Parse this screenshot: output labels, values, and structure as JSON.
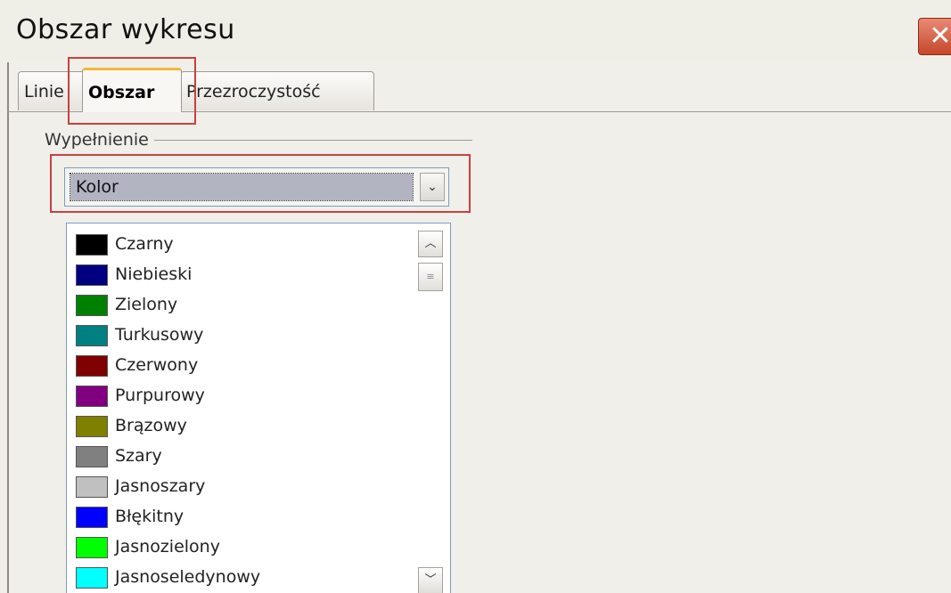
{
  "window": {
    "title": "Obszar wykresu",
    "close_glyph": "✕"
  },
  "tabs": [
    {
      "label": "Linie"
    },
    {
      "label": "Obszar"
    },
    {
      "label": "Przezroczystość"
    }
  ],
  "fill": {
    "group_label": "Wypełnienie",
    "selected": "Kolor",
    "dropdown_glyph": "⌄"
  },
  "colors": [
    {
      "label": "Czarny",
      "color": "#000000"
    },
    {
      "label": "Niebieski",
      "color": "#000080"
    },
    {
      "label": "Zielony",
      "color": "#008000"
    },
    {
      "label": "Turkusowy",
      "color": "#008080"
    },
    {
      "label": "Czerwony",
      "color": "#800000"
    },
    {
      "label": "Purpurowy",
      "color": "#800080"
    },
    {
      "label": "Brązowy",
      "color": "#808000"
    },
    {
      "label": "Szary",
      "color": "#808080"
    },
    {
      "label": "Jasnoszary",
      "color": "#c0c0c0"
    },
    {
      "label": "Błękitny",
      "color": "#0000ff"
    },
    {
      "label": "Jasnozielony",
      "color": "#00ff00"
    },
    {
      "label": "Jasnoseledynowy",
      "color": "#00ffff"
    }
  ],
  "scrollbar": {
    "up_glyph": "︿",
    "thumb_glyph": "≡",
    "down_glyph": "﹀"
  }
}
